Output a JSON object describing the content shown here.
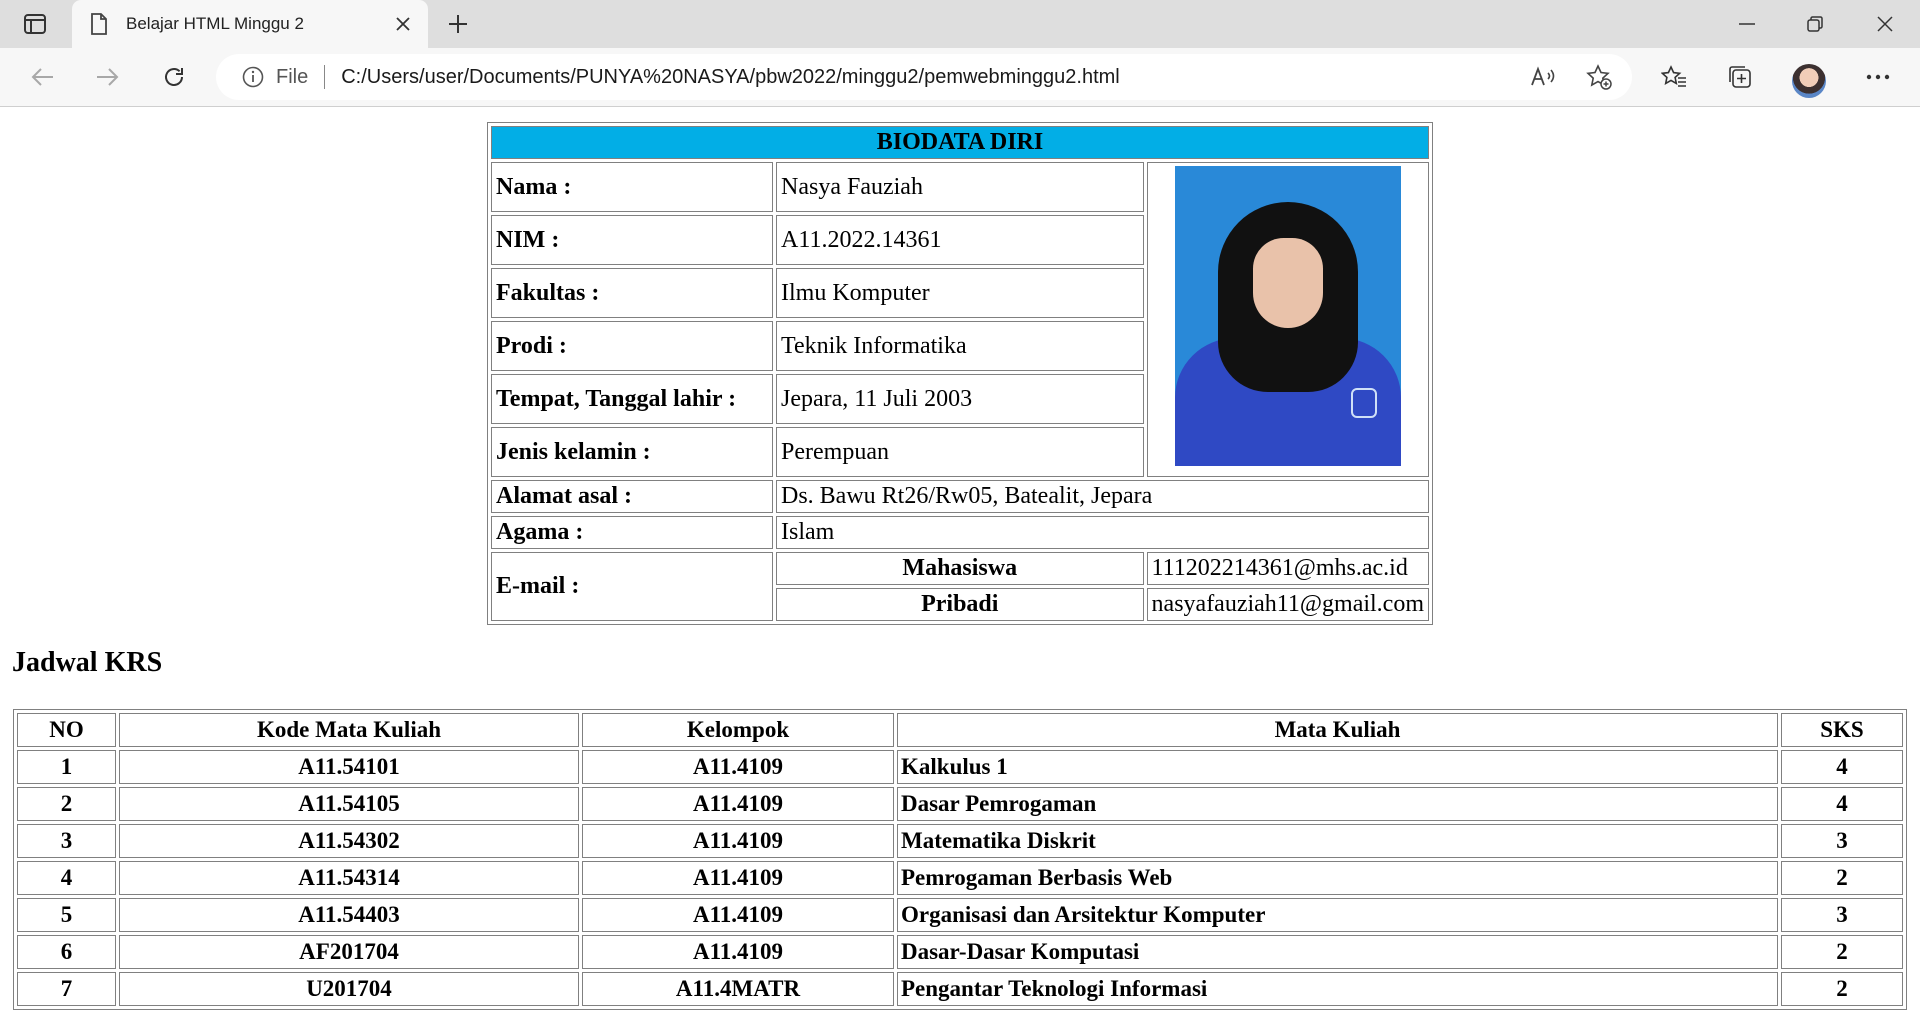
{
  "browser": {
    "tab_title": "Belajar HTML Minggu 2",
    "url_scheme": "File",
    "url": "C:/Users/user/Documents/PUNYA%20NASYA/pbw2022/minggu2/pemwebminggu2.html"
  },
  "biodata": {
    "title": "BIODATA DIRI",
    "rows": [
      {
        "label": "Nama :",
        "value": "Nasya Fauziah"
      },
      {
        "label": "NIM :",
        "value": "A11.2022.14361"
      },
      {
        "label": "Fakultas :",
        "value": "Ilmu Komputer"
      },
      {
        "label": "Prodi :",
        "value": "Teknik Informatika"
      },
      {
        "label": "Tempat, Tanggal lahir :",
        "value": "Jepara, 11 Juli 2003"
      },
      {
        "label": "Jenis kelamin :",
        "value": "Perempuan"
      },
      {
        "label": "Alamat asal :",
        "value": "Ds. Bawu Rt26/Rw05, Batealit, Jepara"
      },
      {
        "label": "Agama :",
        "value": "Islam"
      }
    ],
    "email": {
      "label": "E-mail :",
      "mahasiswa_label": "Mahasiswa",
      "mahasiswa_value": "111202214361@mhs.ac.id",
      "pribadi_label": "Pribadi",
      "pribadi_value": "nasyafauziah11@gmail.com"
    }
  },
  "krs": {
    "title": "Jadwal KRS",
    "headers": [
      "NO",
      "Kode Mata Kuliah",
      "Kelompok",
      "Mata Kuliah",
      "SKS"
    ],
    "rows": [
      [
        "1",
        "A11.54101",
        "A11.4109",
        "Kalkulus 1",
        "4"
      ],
      [
        "2",
        "A11.54105",
        "A11.4109",
        "Dasar Pemrogaman",
        "4"
      ],
      [
        "3",
        "A11.54302",
        "A11.4109",
        "Matematika Diskrit",
        "3"
      ],
      [
        "4",
        "A11.54314",
        "A11.4109",
        "Pemrogaman Berbasis Web",
        "2"
      ],
      [
        "5",
        "A11.54403",
        "A11.4109",
        "Organisasi dan Arsitektur Komputer",
        "3"
      ],
      [
        "6",
        "AF201704",
        "A11.4109",
        "Dasar-Dasar Komputasi",
        "2"
      ],
      [
        "7",
        "U201704",
        "A11.4MATR",
        "Pengantar Teknologi Informasi",
        "2"
      ]
    ]
  }
}
